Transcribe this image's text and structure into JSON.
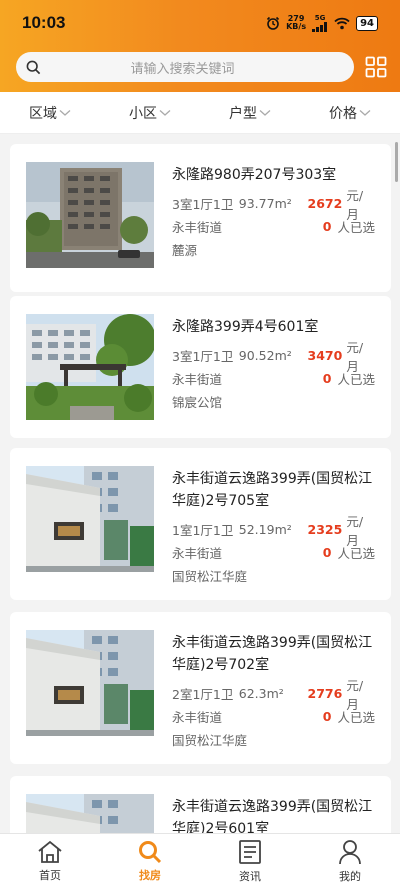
{
  "status_bar": {
    "time": "10:03",
    "net_speed_value": "279",
    "net_speed_unit": "KB/s",
    "network": "5G",
    "battery": "94"
  },
  "search": {
    "placeholder": "请输入搜索关键词"
  },
  "filters": [
    {
      "label": "区域"
    },
    {
      "label": "小区"
    },
    {
      "label": "户型"
    },
    {
      "label": "价格"
    }
  ],
  "listings": [
    {
      "title": "永隆路980弄207号303室",
      "layout": "3室1厅1卫",
      "area": "93.77m²",
      "price": "2672",
      "price_unit": "元/月",
      "street": "永丰街道",
      "selected_count": "0",
      "selected_unit": "人已选",
      "estate": "麓源",
      "image": "apartment-tower-photo"
    },
    {
      "title": "永隆路399弄4号601室",
      "layout": "3室1厅1卫",
      "area": "90.52m²",
      "price": "3470",
      "price_unit": "元/月",
      "street": "永丰街道",
      "selected_count": "0",
      "selected_unit": "人已选",
      "estate": "锦宸公馆",
      "image": "garden-pavilion-photo"
    },
    {
      "title": "永丰街道云逸路399弄(国贸松江华庭)2号705室",
      "layout": "1室1厅1卫",
      "area": "52.19m²",
      "price": "2325",
      "price_unit": "元/月",
      "street": "永丰街道",
      "selected_count": "0",
      "selected_unit": "人已选",
      "estate": "国贸松江华庭",
      "image": "estate-entrance-photo"
    },
    {
      "title": "永丰街道云逸路399弄(国贸松江华庭)2号702室",
      "layout": "2室1厅1卫",
      "area": "62.3m²",
      "price": "2776",
      "price_unit": "元/月",
      "street": "永丰街道",
      "selected_count": "0",
      "selected_unit": "人已选",
      "estate": "国贸松江华庭",
      "image": "estate-entrance-photo"
    },
    {
      "title": "永丰街道云逸路399弄(国贸松江华庭)2号601室",
      "image": "estate-entrance-photo"
    }
  ],
  "tabbar": [
    {
      "label": "首页",
      "icon": "home-icon"
    },
    {
      "label": "找房",
      "icon": "search-icon",
      "active": true
    },
    {
      "label": "资讯",
      "icon": "news-icon"
    },
    {
      "label": "我的",
      "icon": "profile-icon"
    }
  ],
  "colors": {
    "header_start": "#f6a623",
    "header_end": "#ee7a12",
    "price": "#e53d1e",
    "active_tab": "#f08a1a"
  }
}
